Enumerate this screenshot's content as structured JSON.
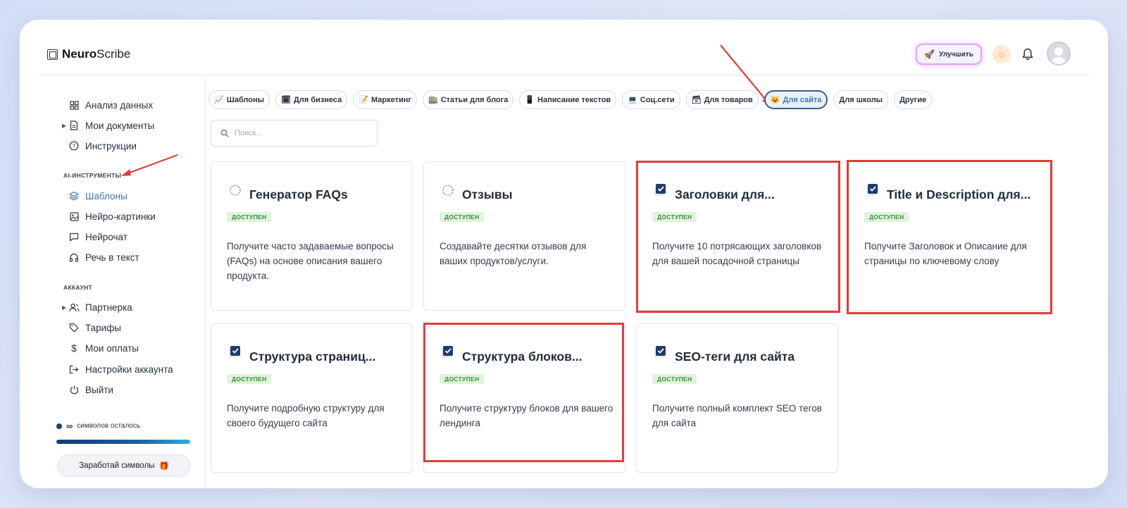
{
  "app": {
    "brand_bold": "Neuro",
    "brand_light": "Scribe"
  },
  "header": {
    "upgrade_label": "Улучшить"
  },
  "sidebar": {
    "top_items": [
      {
        "label": "Анализ данных",
        "icon": "grid-icon"
      },
      {
        "label": "Мои документы",
        "icon": "document-icon"
      },
      {
        "label": "Инструкции",
        "icon": "help-circle-icon"
      }
    ],
    "ai_section": "AI-ИНСТРУМЕНТЫ",
    "ai_items": [
      {
        "label": "Шаблоны",
        "icon": "layers-icon",
        "active": true
      },
      {
        "label": "Нейро-картинки",
        "icon": "image-icon"
      },
      {
        "label": "Нейрочат",
        "icon": "chat-icon"
      },
      {
        "label": "Речь в текст",
        "icon": "headphones-icon"
      }
    ],
    "account_section": "АККАУНТ",
    "account_items": [
      {
        "label": "Партнерка",
        "icon": "users-icon"
      },
      {
        "label": "Тарифы",
        "icon": "tag-icon"
      },
      {
        "label": "Мои оплаты",
        "icon": "dollar-icon"
      },
      {
        "label": "Настройки аккаунта",
        "icon": "logout-arrow-icon"
      },
      {
        "label": "Выйти",
        "icon": "power-icon"
      }
    ],
    "symbols_value": "∞",
    "symbols_label": "символов осталось",
    "symbols_progress": 1.0,
    "earn_label": "Заработай символы"
  },
  "filters": [
    {
      "icon": "📈",
      "label": "Шаблоны"
    },
    {
      "icon": "🗓",
      "label": "Для бизнеса"
    },
    {
      "icon": "📝",
      "label": "Маркетинг"
    },
    {
      "icon": "🏬",
      "label": "Статьи для блога"
    },
    {
      "icon": "📱",
      "label": "Написание текстов"
    },
    {
      "icon": "💻",
      "label": "Соц.сети"
    },
    {
      "icon": "🗃",
      "label": "Для товаров"
    },
    {
      "icon": "😺",
      "label": "Для сайта",
      "active": true
    },
    {
      "icon": "",
      "label": "Для школы"
    },
    {
      "icon": "",
      "label": "Другие"
    }
  ],
  "search": {
    "placeholder": "Поиск..."
  },
  "cards": [
    {
      "title": "Генератор FAQs",
      "badge": "ДОСТУПЕН",
      "desc": "Получите часто задаваемые вопросы (FAQs) на основе описания вашего продукта.",
      "icon": "dotted-circle-icon"
    },
    {
      "title": "Отзывы",
      "badge": "ДОСТУПЕН",
      "desc": "Создавайте десятки отзывов для ваших продуктов/услуги.",
      "icon": "dotted-circle-icon"
    },
    {
      "title": "Заголовки для...",
      "badge": "ДОСТУПЕН",
      "desc": "Получите 10 потрясающих заголовков для вашей посадочной страницы",
      "icon": "checkbox-icon"
    },
    {
      "title": "Title и Description для...",
      "badge": "ДОСТУПЕН",
      "desc": "Получите Заголовок и Описание для страницы по ключевому слову",
      "icon": "checkbox-icon"
    },
    {
      "title": "Структура страниц...",
      "badge": "ДОСТУПЕН",
      "desc": "Получите подробную структуру для своего будущего сайта",
      "icon": "checkbox-icon"
    },
    {
      "title": "Структура блоков...",
      "badge": "ДОСТУПЕН",
      "desc": "Получите структуру блоков для вашего лендинга",
      "icon": "checkbox-icon"
    },
    {
      "title": "SEO-теги для сайта",
      "badge": "ДОСТУПЕН",
      "desc": "Получите полный комплект SEO тегов для сайта",
      "icon": "checkbox-icon"
    }
  ],
  "colors": {
    "accent": "#3a7ab4",
    "highlight": "#e53b3b",
    "badge_bg": "#dff3dd",
    "badge_text": "#3c8a3c"
  }
}
